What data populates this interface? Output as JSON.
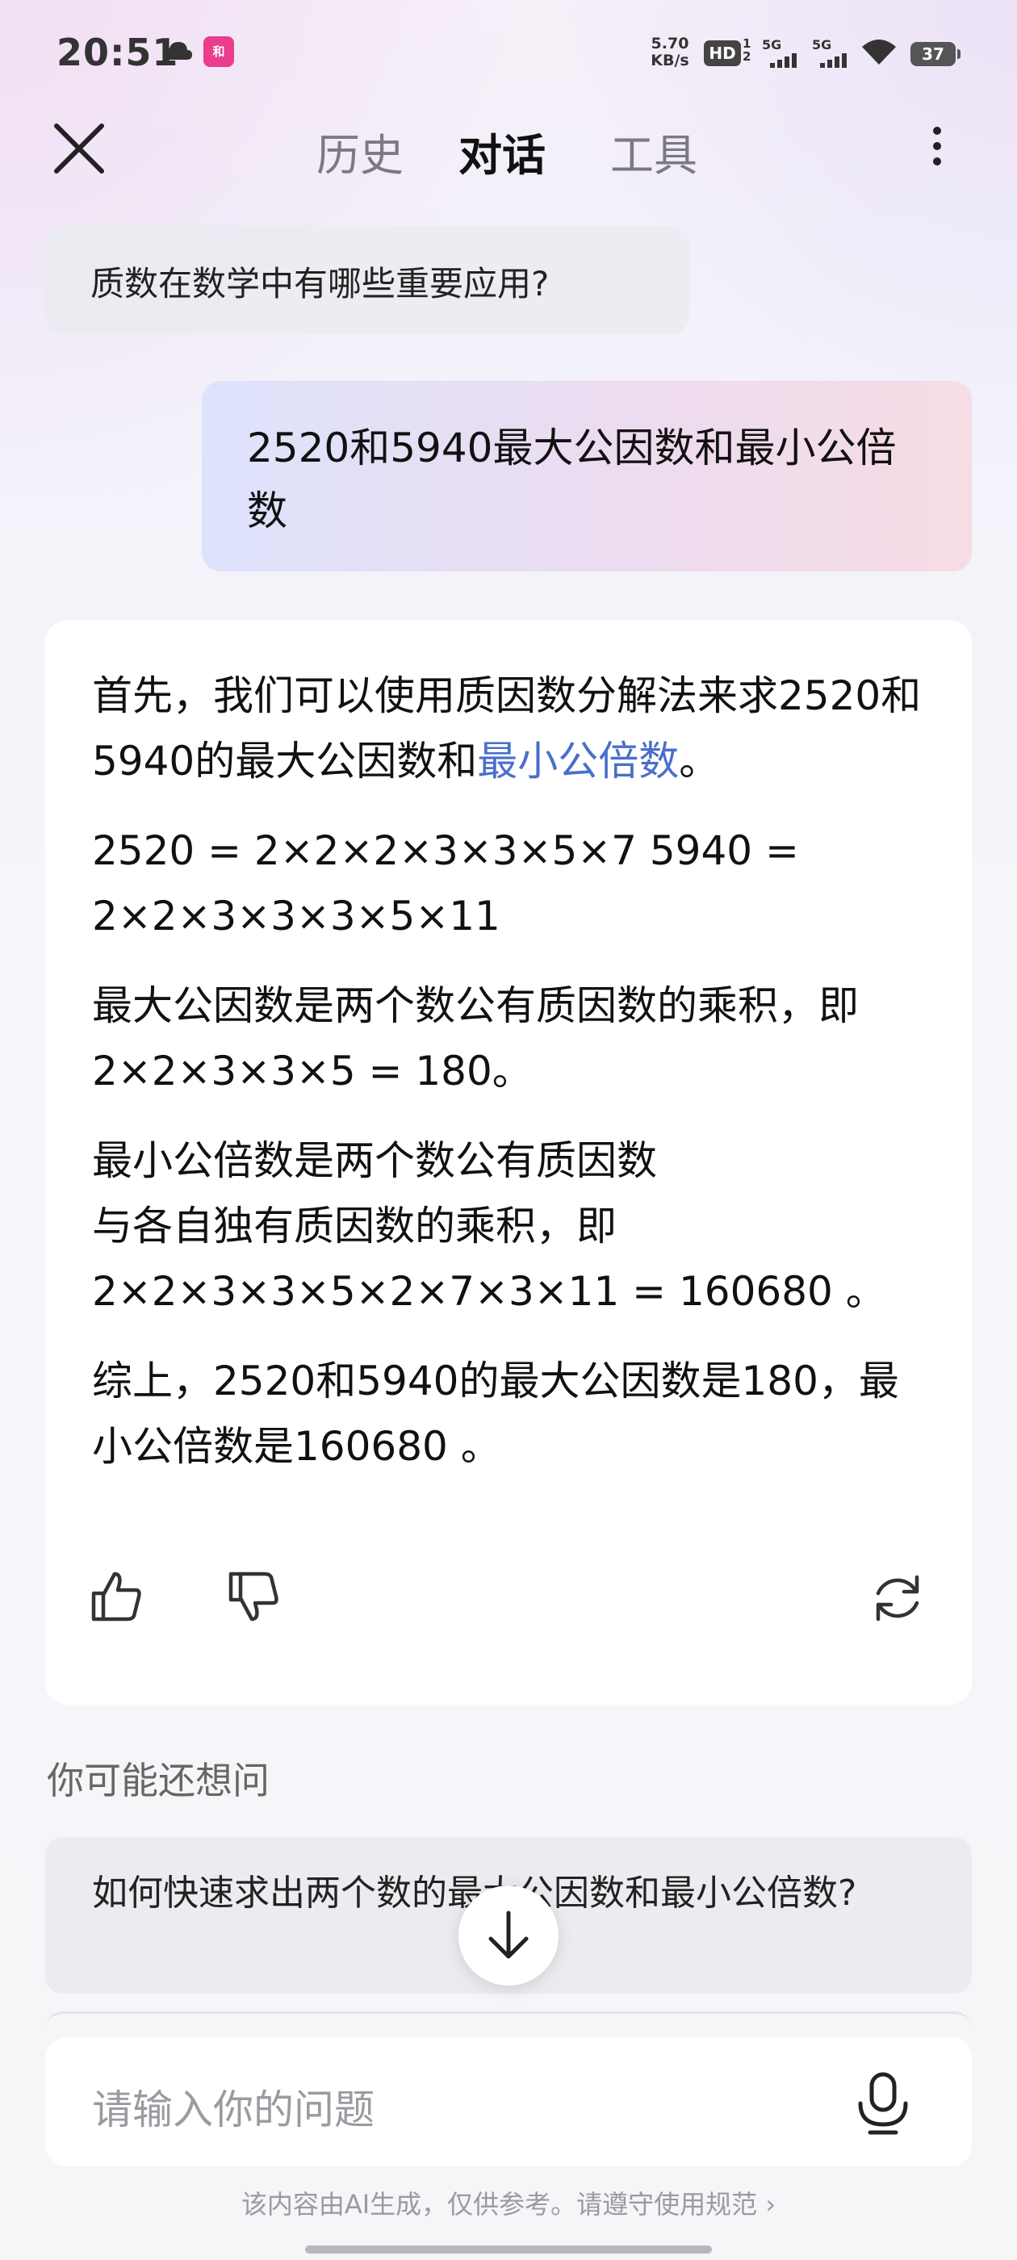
{
  "status_bar": {
    "time": "20:51",
    "app_badge": "和",
    "net_speed_value": "5.70",
    "net_speed_unit": "KB/s",
    "hd_label": "HD",
    "hd_sub_top": "1",
    "hd_sub_bottom": "2",
    "signal1_label": "5G",
    "signal2_label": "5G",
    "battery": "37"
  },
  "nav": {
    "tabs": [
      {
        "label": "历史"
      },
      {
        "label": "对话"
      },
      {
        "label": "工具"
      }
    ],
    "active_tab": "对话"
  },
  "chat": {
    "previous_question": "质数在数学中有哪些重要应用?",
    "user_message": "2520和5940最大公因数和最小公倍数",
    "answer": {
      "p1_text": "首先，我们可以使用质因数分解法来求2520和5940的最大公因数和",
      "p1_link": "最小公倍数",
      "p1_end": "。",
      "p2": "2520 = 2×2×2×3×3×5×7 5940 = 2×2×3×3×3×5×11",
      "p3": "最大公因数是两个数公有质因数的乘积，即2×2×3×3×5 = 180。",
      "p4_line1": "最小公倍数是两个数公有质因数",
      "p4_line2": "与各自独有质因数的乘积，即",
      "p4_line3": "2×2×3×3×5×2×7×3×11 = 160680 。",
      "p5": "综上，2520和5940的最大公因数是180，最小公倍数是160680 。"
    }
  },
  "suggestions": {
    "title": "你可能还想问",
    "items": [
      {
        "text": "如何快速求出两个数的最大公因数和最小公倍数?"
      }
    ]
  },
  "input": {
    "placeholder": "请输入你的问题"
  },
  "footer": {
    "disclaimer": "该内容由AI生成，仅供参考。请遵守",
    "rule_link": "使用规范",
    "rule_arrow": "›"
  },
  "colors": {
    "link": "#4a6fc9",
    "badge": "#e83e8c"
  }
}
